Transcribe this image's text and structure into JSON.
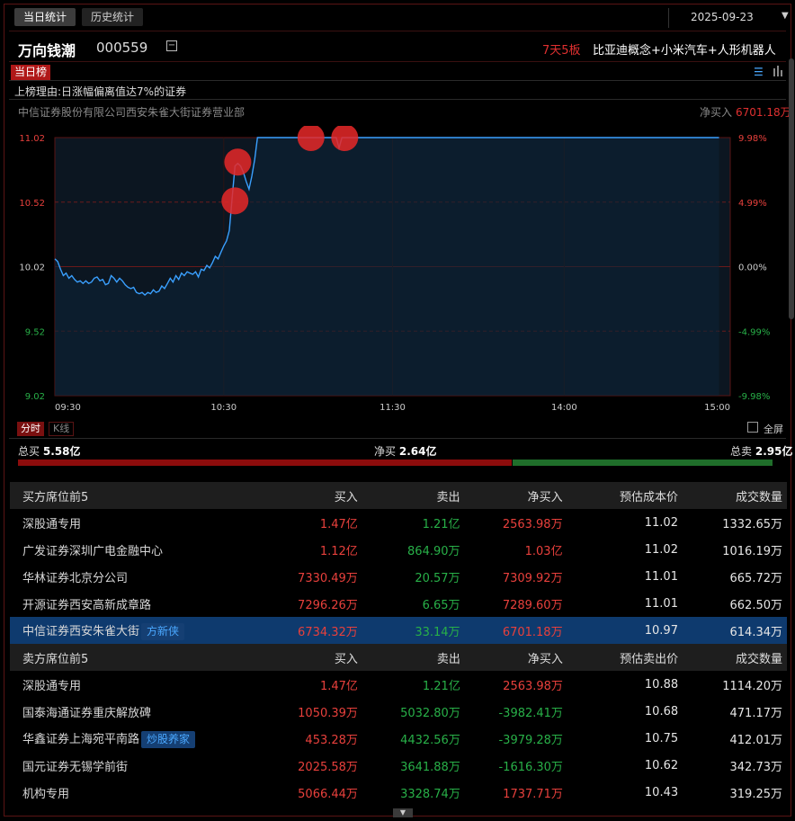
{
  "header": {
    "tabs": [
      {
        "label": "当日统计",
        "active": true
      },
      {
        "label": "历史统计",
        "active": false
      }
    ],
    "date": "2025-09-23",
    "stock_name": "万向钱潮",
    "stock_code": "000559",
    "streak": "7天5板",
    "concepts": "比亚迪概念+小米汽车+人形机器人"
  },
  "board": {
    "badge": "当日榜",
    "reason": "上榜理由:日涨幅偏离值达7%的证券",
    "broker": "中信证券股份有限公司西安朱雀大街证券营业部",
    "net_label": "净买入",
    "net_value": "6701.18万"
  },
  "chart_data": {
    "type": "line",
    "title": "",
    "xlabel": "",
    "ylabel": "",
    "y_ticks_left": [
      "11.02",
      "10.52",
      "10.02",
      "9.52",
      "9.02"
    ],
    "y_ticks_right": [
      "9.98%",
      "4.99%",
      "0.00%",
      "-4.99%",
      "-9.98%"
    ],
    "x_ticks": [
      "09:30",
      "10:30",
      "11:30",
      "14:00",
      "15:00"
    ],
    "ylim": [
      9.02,
      11.02
    ],
    "prev_close": 10.02,
    "series": [
      {
        "values": [
          10.08,
          10.06,
          10.0,
          9.95,
          9.97,
          9.93,
          9.95,
          9.92,
          9.9,
          9.91,
          9.89,
          9.91,
          9.89,
          9.9,
          9.93,
          9.94,
          9.91,
          9.92,
          9.88,
          9.89,
          9.95,
          9.93,
          9.9,
          9.93,
          9.91,
          9.88,
          9.86,
          9.85,
          9.86,
          9.82,
          9.81,
          9.82,
          9.8,
          9.82,
          9.81,
          9.84,
          9.82,
          9.83,
          9.87,
          9.85,
          9.89,
          9.93,
          9.9,
          9.95,
          9.92,
          9.97,
          9.95,
          9.98,
          9.97,
          9.96,
          9.98,
          9.94,
          10.0,
          9.99,
          10.03,
          10.01,
          10.05,
          10.1,
          10.08,
          10.13,
          10.18,
          10.22,
          10.3,
          10.55,
          10.8,
          10.82,
          10.8,
          10.75,
          10.68,
          10.62,
          10.72,
          10.85,
          11.02,
          11.02,
          11.02,
          11.02,
          11.02,
          11.02,
          11.02,
          11.02,
          11.02,
          11.02,
          11.02,
          11.02,
          11.02,
          11.02,
          11.02,
          11.02,
          11.02,
          11.02,
          11.02,
          11.02,
          11.02,
          11.02,
          11.02,
          11.02,
          11.02,
          11.02,
          11.02,
          11.02,
          11.02,
          10.94,
          11.02,
          11.02,
          11.02,
          11.02,
          11.02,
          11.02,
          11.02,
          11.02,
          11.02,
          11.02,
          11.02,
          11.02,
          11.02,
          11.02,
          11.02,
          11.02,
          11.02,
          11.02,
          11.02,
          11.02,
          11.02,
          11.02,
          11.02,
          11.02,
          11.02,
          11.02,
          11.02,
          11.02,
          11.02,
          11.02,
          11.02,
          11.02,
          11.02,
          11.02,
          11.02,
          11.02,
          11.02,
          11.02,
          11.02,
          11.02,
          11.02,
          11.02,
          11.02,
          11.02,
          11.02,
          11.02,
          11.02,
          11.02,
          11.02,
          11.02,
          11.02,
          11.02,
          11.02,
          11.02,
          11.02,
          11.02,
          11.02,
          11.02,
          11.02,
          11.02,
          11.02,
          11.02,
          11.02,
          11.02,
          11.02,
          11.02,
          11.02,
          11.02,
          11.02,
          11.02,
          11.02,
          11.02,
          11.02,
          11.02,
          11.02,
          11.02,
          11.02,
          11.02,
          11.02,
          11.02,
          11.02,
          11.02,
          11.02,
          11.02,
          11.02,
          11.02,
          11.02,
          11.02,
          11.02,
          11.02,
          11.02,
          11.02,
          11.02,
          11.02,
          11.02,
          11.02,
          11.02,
          11.02,
          11.02,
          11.02,
          11.02,
          11.02,
          11.02,
          11.02,
          11.02,
          11.02,
          11.02,
          11.02,
          11.02,
          11.02,
          11.02,
          11.02,
          11.02,
          11.02,
          11.02,
          11.02,
          11.02,
          11.02,
          11.02,
          11.02,
          11.02,
          11.02,
          11.02,
          11.02,
          11.02,
          11.02,
          11.02,
          11.02,
          11.02,
          11.02,
          11.02,
          11.02,
          11.02,
          11.02,
          11.02
        ]
      }
    ],
    "markers": [
      {
        "index": 65,
        "value": 10.83
      },
      {
        "index": 64,
        "value": 10.53
      },
      {
        "index": 91,
        "value": 11.02
      },
      {
        "index": 103,
        "value": 11.02
      }
    ]
  },
  "chart_controls": {
    "tab_fenshi": "分时",
    "tab_kline": "K线",
    "fullscreen": "全屏"
  },
  "summary": {
    "total_buy_label": "总买",
    "total_buy": "5.58亿",
    "net_buy_label": "净买",
    "net_buy": "2.64亿",
    "total_sell_label": "总卖",
    "total_sell": "2.95亿",
    "buy_fraction": 0.654
  },
  "buy_table": {
    "headers": [
      "买方席位前5",
      "买入",
      "卖出",
      "净买入",
      "预估成本价",
      "成交数量"
    ],
    "rows": [
      {
        "name": "深股通专用",
        "tag": "",
        "buy": "1.47亿",
        "sell": "1.21亿",
        "net": "2563.98万",
        "price": "11.02",
        "qty": "1332.65万"
      },
      {
        "name": "广发证券深圳广电金融中心",
        "tag": "",
        "buy": "1.12亿",
        "sell": "864.90万",
        "net": "1.03亿",
        "price": "11.02",
        "qty": "1016.19万"
      },
      {
        "name": "华林证券北京分公司",
        "tag": "",
        "buy": "7330.49万",
        "sell": "20.57万",
        "net": "7309.92万",
        "price": "11.01",
        "qty": "665.72万"
      },
      {
        "name": "开源证券西安高新成章路",
        "tag": "",
        "buy": "7296.26万",
        "sell": "6.65万",
        "net": "7289.60万",
        "price": "11.01",
        "qty": "662.50万"
      },
      {
        "name": "中信证券西安朱雀大街",
        "tag": "方新侠",
        "buy": "6734.32万",
        "sell": "33.14万",
        "net": "6701.18万",
        "price": "10.97",
        "qty": "614.34万",
        "highlight": true
      }
    ]
  },
  "sell_table": {
    "headers": [
      "卖方席位前5",
      "买入",
      "卖出",
      "净买入",
      "预估卖出价",
      "成交数量"
    ],
    "rows": [
      {
        "name": "深股通专用",
        "tag": "",
        "buy": "1.47亿",
        "sell": "1.21亿",
        "net": "2563.98万",
        "price": "10.88",
        "qty": "1114.20万"
      },
      {
        "name": "国泰海通证券重庆解放碑",
        "tag": "",
        "buy": "1050.39万",
        "sell": "5032.80万",
        "net": "-3982.41万",
        "price": "10.68",
        "qty": "471.17万"
      },
      {
        "name": "华鑫证券上海宛平南路",
        "tag": "炒股养家",
        "buy": "453.28万",
        "sell": "4432.56万",
        "net": "-3979.28万",
        "price": "10.75",
        "qty": "412.01万"
      },
      {
        "name": "国元证券无锡学前街",
        "tag": "",
        "buy": "2025.58万",
        "sell": "3641.88万",
        "net": "-1616.30万",
        "price": "10.62",
        "qty": "342.73万"
      },
      {
        "name": "机构专用",
        "tag": "",
        "buy": "5066.44万",
        "sell": "3328.74万",
        "net": "1737.71万",
        "price": "10.43",
        "qty": "319.25万"
      }
    ]
  },
  "colors": {
    "up": "#e8403c",
    "down": "#28b048",
    "line": "#3aa0ff",
    "highlight": "#0e3a6e",
    "accent": "#b01818"
  }
}
